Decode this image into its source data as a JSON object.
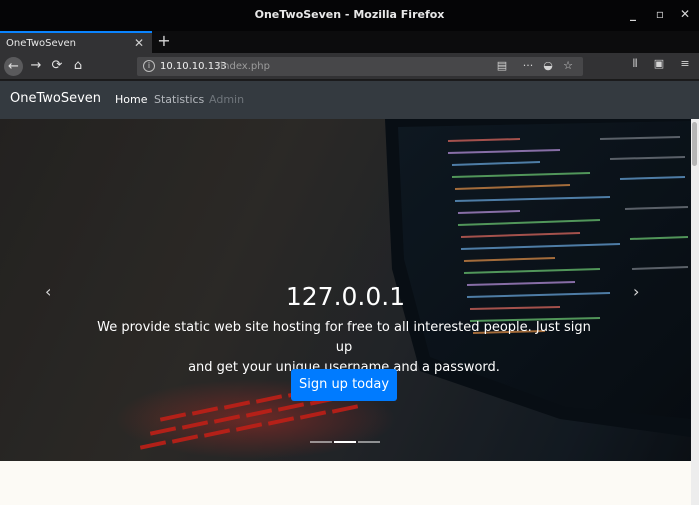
{
  "window": {
    "title": "OneTwoSeven - Mozilla Firefox",
    "controls": [
      "_",
      "▫",
      "✕"
    ]
  },
  "tabs": [
    {
      "label": "OneTwoSeven",
      "close": "✕"
    }
  ],
  "new_tab": "+",
  "toolbar": {
    "back": "←",
    "forward": "→",
    "reload": "⟳",
    "home": "⌂",
    "info_icon": "i",
    "url_host": "10.10.10.133",
    "url_path": "/index.php",
    "reader_icon": "▤",
    "more_icon": "···",
    "pocket_icon": "◒",
    "bookmark_icon": "☆",
    "library_icon": "⫴",
    "sidebar_icon": "▣",
    "menu_icon": "≡"
  },
  "site_nav": {
    "brand": "OneTwoSeven",
    "links": [
      {
        "label": "Home",
        "state": "active"
      },
      {
        "label": "Statistics",
        "state": "normal"
      },
      {
        "label": "Admin",
        "state": "disabled"
      }
    ]
  },
  "colors": {
    "nav_active": "#ffffff",
    "nav_normal": "#b4b8bd",
    "nav_disabled": "#6f757b",
    "primary": "#007bff"
  },
  "hero": {
    "title": "127.0.0.1",
    "text_line1": "We provide static web site hosting for free to all interested people. Just sign up",
    "text_line2": "and get your unique username and a password.",
    "button": "Sign up today",
    "prev": "‹",
    "next": "›",
    "slides": 3,
    "active_slide": 2
  }
}
